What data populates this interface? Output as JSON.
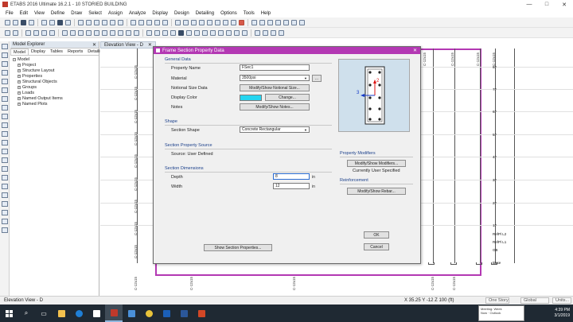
{
  "app": {
    "title": "ETABS 2016 Ultimate 16.2.1 - 10 STORIED BUILDING",
    "window_buttons": [
      "—",
      "□",
      "✕"
    ]
  },
  "menu": [
    "File",
    "Edit",
    "View",
    "Define",
    "Draw",
    "Select",
    "Assign",
    "Analyze",
    "Display",
    "Design",
    "Detailing",
    "Options",
    "Tools",
    "Help"
  ],
  "model_explorer": {
    "title": "Model Explorer",
    "tabs": [
      "Model",
      "Display",
      "Tables",
      "Reports",
      "Detailing"
    ],
    "tree_root": "Model",
    "tree_items": [
      "Project",
      "Structure Layout",
      "Properties",
      "Structural Objects",
      "Groups",
      "Loads",
      "Named Output Items",
      "Named Plots"
    ]
  },
  "elevation": {
    "tab_label": "Elevation View - D",
    "column_labels_top": [
      "C-12x15",
      "C-12x15",
      "C-12x15",
      "C-12x15"
    ],
    "column_labels_left": [
      "C-12x15",
      "C-12x15",
      "C-12x15",
      "C-12x15",
      "C-12x15",
      "C-12x15",
      "C-12x15",
      "C-12x15",
      "C-12x15",
      "C-12x15"
    ],
    "column_labels_bottom": [
      "C-12x15",
      "C-12x15",
      "C-12x15",
      "C-12x15"
    ],
    "levels": [
      "8F",
      "7F",
      "6F",
      "5F",
      "4F",
      "3F",
      "2F",
      "1F",
      "RefPl L2",
      "RefPl L1",
      "GB",
      "Base"
    ]
  },
  "dialog": {
    "title": "Frame Section Property Data",
    "general_data": {
      "heading": "General Data",
      "property_name_label": "Property Name",
      "property_name_value": "FSec1",
      "material_label": "Material",
      "material_value": "3500psi",
      "material_more": "...",
      "notional_label": "Notional Size Data",
      "notional_button": "Modify/Show Notional Size...",
      "color_label": "Display Color",
      "color_button": "Change...",
      "color_value": "#25d5f0",
      "notes_label": "Notes",
      "notes_button": "Modify/Show Notes..."
    },
    "shape": {
      "heading": "Shape",
      "section_shape_label": "Section Shape",
      "section_shape_value": "Concrete Rectangular"
    },
    "source": {
      "heading": "Section Property Source",
      "source_text": "Source:  User Defined"
    },
    "dimensions": {
      "heading": "Section Dimensions",
      "depth_label": "Depth",
      "depth_value": "8",
      "width_label": "Width",
      "width_value": "12",
      "unit": "in"
    },
    "preview_axis": {
      "vertical": "2",
      "horizontal": "3"
    },
    "property_modifiers": {
      "heading": "Property Modifiers",
      "button": "Modify/Show Modifiers...",
      "status": "Currently User Specified"
    },
    "reinforcement": {
      "heading": "Reinforcement",
      "button": "Modify/Show Rebar..."
    },
    "show_section_button": "Show Section Properties...",
    "ok_button": "OK",
    "cancel_button": "Cancel"
  },
  "status": {
    "view": "Elevation View - D",
    "coords": "X 35.25  Y -12  Z 100 (ft)",
    "story": "One Story",
    "global": "Global",
    "units": "Units..."
  },
  "taskbar": {
    "clock_time": "4:39 PM",
    "clock_date": "3/1/2019",
    "notif_title": "Meeting: Week",
    "notif_line": "Now · Outlook"
  }
}
